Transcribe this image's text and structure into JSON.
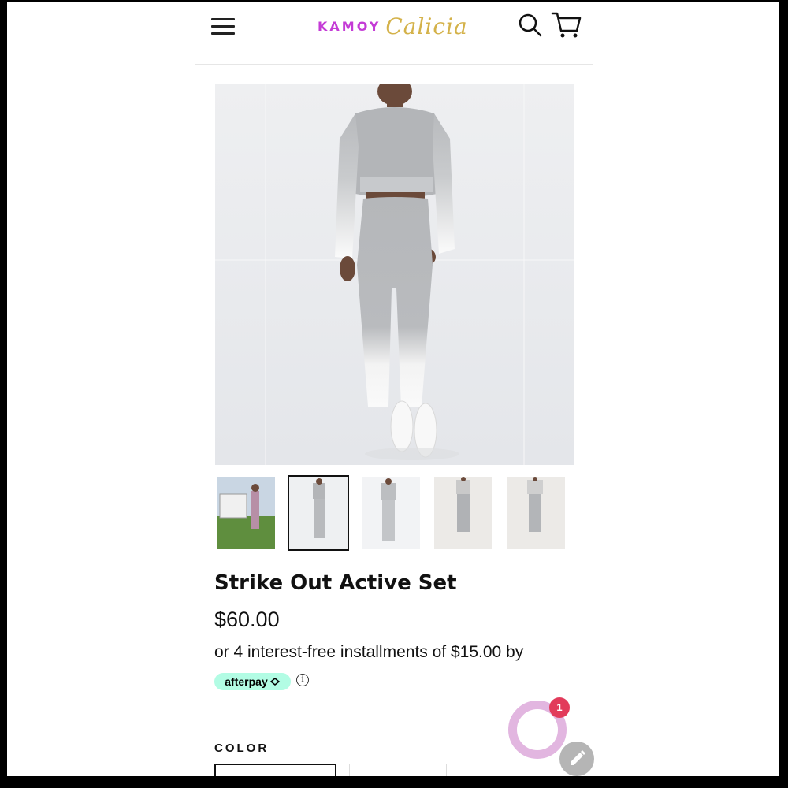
{
  "header": {
    "logo_word": "KAMOY",
    "logo_script": "Calicia"
  },
  "product": {
    "title": "Strike Out Active Set",
    "price": "$60.00",
    "installments_text": "or 4 interest-free installments of $15.00 by",
    "afterpay_label": "afterpay",
    "info_glyph": "i",
    "color_label": "COLOR",
    "selected_thumbnail": 2
  },
  "chat": {
    "badge_count": "1"
  },
  "icons": {
    "menu": "menu-icon",
    "search": "search-icon",
    "cart": "cart-icon",
    "edit": "pencil-icon",
    "info": "info-icon"
  },
  "colors": {
    "logo_word": "#c43bd6",
    "logo_script": "#d4b24a",
    "afterpay": "#b2fce4",
    "chat_ring": "#e2b6e0",
    "badge": "#e23b5b"
  }
}
